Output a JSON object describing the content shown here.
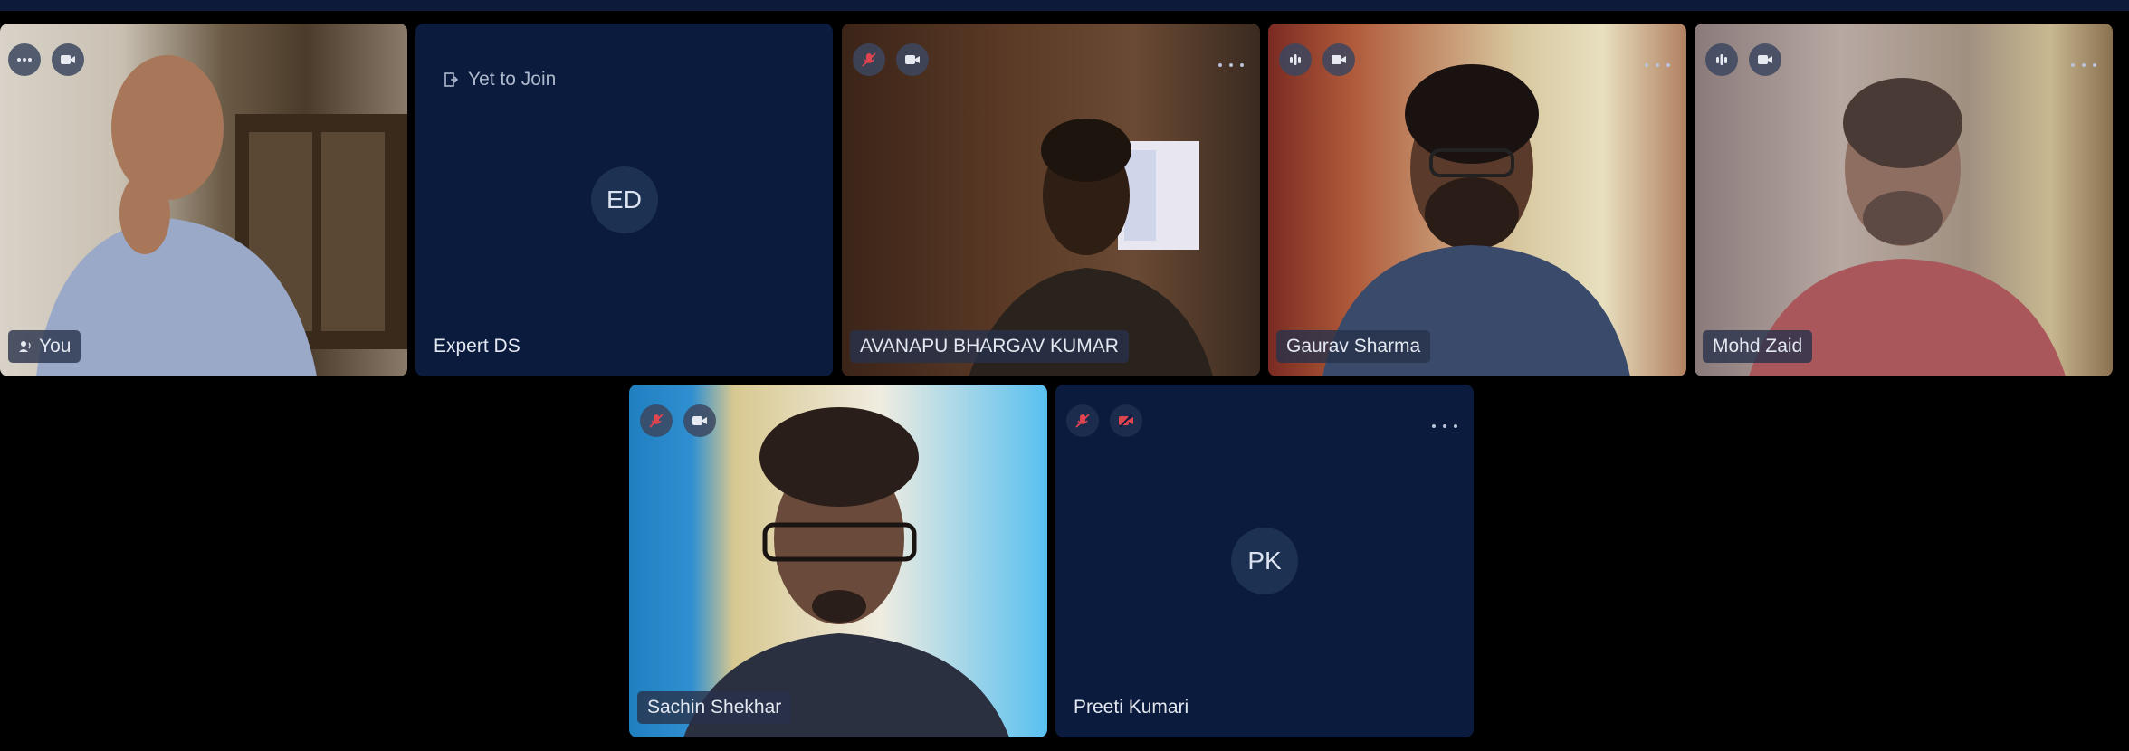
{
  "participants": [
    {
      "name": "You",
      "type": "video",
      "speaking": true
    },
    {
      "name": "Expert DS",
      "status": "Yet to Join",
      "initials": "ED"
    },
    {
      "name": "AVANAPU BHARGAV KUMAR",
      "type": "video",
      "mic": "muted"
    },
    {
      "name": "Gaurav Sharma",
      "type": "video",
      "mic": "active"
    },
    {
      "name": "Mohd Zaid",
      "type": "video",
      "mic": "active"
    },
    {
      "name": "Sachin Shekhar",
      "type": "video",
      "mic": "muted"
    },
    {
      "name": "Preeti Kumari",
      "initials": "PK",
      "mic": "muted",
      "camera": "off"
    }
  ],
  "colors": {
    "tile_bg": "#0b1b3d",
    "page_bg": "#000000",
    "muted_red": "#e0454f"
  },
  "icons": [
    "more-icon",
    "camera-icon",
    "mic-off-icon",
    "audio-level-icon",
    "camera-off-icon",
    "exit-door-icon",
    "speaker-person-icon"
  ]
}
